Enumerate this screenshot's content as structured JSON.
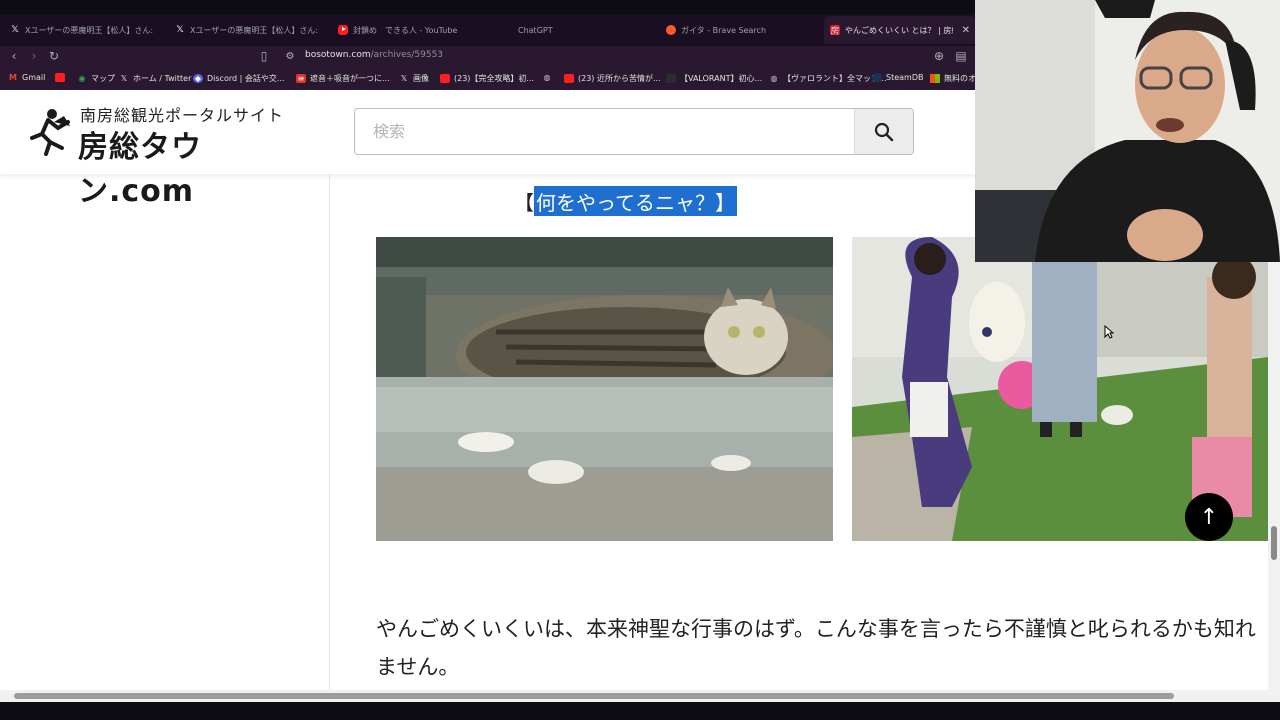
{
  "tabs": [
    {
      "icon": "x-icon",
      "label": "Xユーザーの悪魔明王【松人】さん: 「https:"
    },
    {
      "icon": "x-icon",
      "label": "Xユーザーの悪魔明王【松人】さん: 「https:"
    },
    {
      "icon": "youtube-icon",
      "label": "封鎖め　できる人 - YouTube"
    },
    {
      "icon": "chatgpt-icon",
      "label": "ChatGPT"
    },
    {
      "icon": "brave-icon",
      "label": "ガイタ - Brave Search"
    },
    {
      "icon": "site-icon",
      "label": "やんごめくいくい とは？ | 房総タウン"
    }
  ],
  "address": {
    "domain": "bosotown.com",
    "path": "/archives/59553"
  },
  "bookmarks": [
    {
      "icon": "gmail-icon",
      "label": "Gmail"
    },
    {
      "icon": "youtube-icon",
      "label": ""
    },
    {
      "icon": "maps-icon",
      "label": "マップ"
    },
    {
      "icon": "x-icon",
      "label": "ホーム / Twitter"
    },
    {
      "icon": "discord-icon",
      "label": "Discord | 会話や交..."
    },
    {
      "icon": "app-icon",
      "label": "遮音＋吸音が一つに..."
    },
    {
      "icon": "x-icon",
      "label": "画像"
    },
    {
      "icon": "youtube-icon",
      "label": "(23)【完全攻略】初..."
    },
    {
      "icon": "globe-icon",
      "label": ""
    },
    {
      "icon": "youtube-icon",
      "label": "(23) 近所から苦情が..."
    },
    {
      "icon": "valorant-icon",
      "label": "【VALORANT】初心..."
    },
    {
      "icon": "globe-icon",
      "label": "【ヴァロラント】全マップ..."
    },
    {
      "icon": "steam-icon",
      "label": "SteamDB"
    },
    {
      "icon": "ms-icon",
      "label": "無料のオ"
    }
  ],
  "site": {
    "tagline": "南房総観光ポータルサイト",
    "name": "房総タウン.com",
    "search_placeholder": "検索"
  },
  "article": {
    "heading_open": "【",
    "heading_selected": "何をやってるニャ？】",
    "paragraph": "やんごめくいくいは、本来神聖な行事のはず。こんな事を言ったら不謹慎と叱られるかも知れません。"
  },
  "colors": {
    "selection": "#1f6fd1",
    "tabbar": "#1a0f22",
    "chrome": "#2a1830"
  }
}
